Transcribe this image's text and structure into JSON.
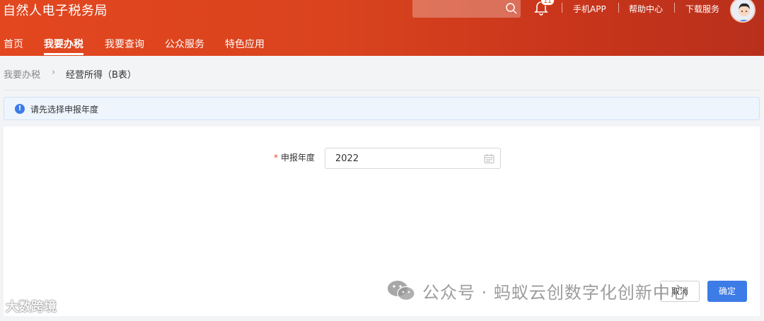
{
  "header": {
    "site_title": "自然人电子税务局",
    "search": {
      "placeholder": ""
    },
    "notifications": {
      "count": "11"
    },
    "links": [
      "手机APP",
      "帮助中心",
      "下载服务"
    ],
    "colors": {
      "primary": "#d9431e",
      "accent": "#3d7be6"
    }
  },
  "nav": {
    "items": [
      "首页",
      "我要办税",
      "我要查询",
      "公众服务",
      "特色应用"
    ],
    "active": "我要办税"
  },
  "breadcrumb": {
    "items": [
      "我要办税",
      "经营所得（B表）"
    ]
  },
  "alert": {
    "text": "请先选择申报年度"
  },
  "form": {
    "year_label": "申报年度",
    "required_mark": "*",
    "year_value": "2022"
  },
  "actions": {
    "cancel_label": "取消",
    "confirm_label": "确定"
  },
  "watermarks": {
    "right": "公众号 · 蚂蚁云创数字化创新中心",
    "left": "大数跨境"
  },
  "icons": [
    "search-icon",
    "bell-icon",
    "calendar-icon",
    "info-icon",
    "chevron-right-icon",
    "wechat-icon",
    "avatar"
  ]
}
